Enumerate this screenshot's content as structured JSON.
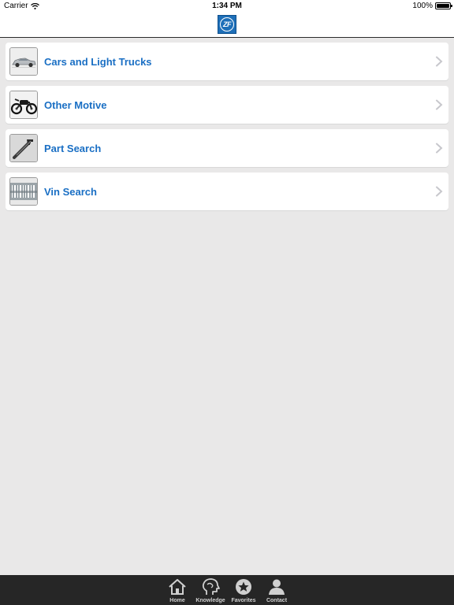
{
  "status_bar": {
    "carrier": "Carrier",
    "time": "1:34 PM",
    "battery": "100%",
    "battery_level": 1.0
  },
  "nav_bar": {
    "logo_text": "ZF",
    "logo_color": "#1e6fb8"
  },
  "menu": {
    "items": [
      {
        "label": "Cars and Light Trucks",
        "icon": "car-thumbnail"
      },
      {
        "label": "Other Motive",
        "icon": "motorcycle-thumbnail"
      },
      {
        "label": "Part Search",
        "icon": "wrench-thumbnail"
      },
      {
        "label": "Vin Search",
        "icon": "barcode-thumbnail"
      }
    ],
    "label_color": "#1a6fc4"
  },
  "tab_bar": {
    "tabs": [
      {
        "label": "Home",
        "icon": "home-icon"
      },
      {
        "label": "Knowledge",
        "icon": "head-icon"
      },
      {
        "label": "Favorites",
        "icon": "star-icon"
      },
      {
        "label": "Contact",
        "icon": "person-icon"
      }
    ]
  }
}
